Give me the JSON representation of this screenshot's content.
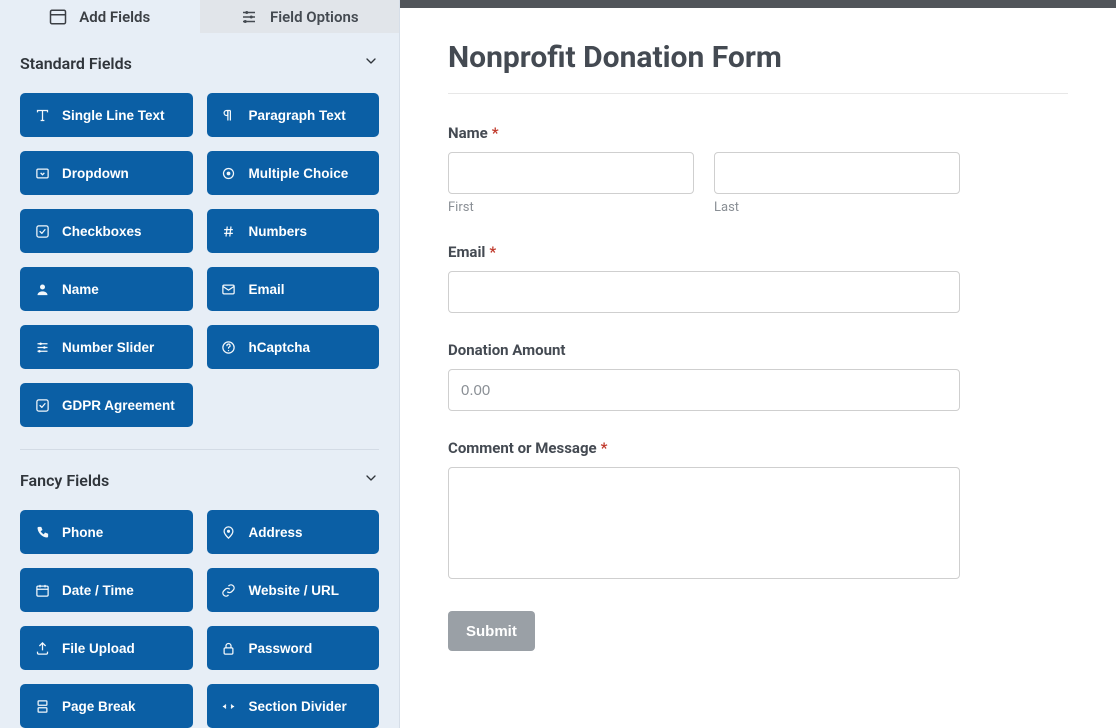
{
  "tabs": {
    "add_fields": "Add Fields",
    "field_options": "Field Options"
  },
  "sections": {
    "standard": {
      "title": "Standard Fields",
      "items": [
        {
          "label": "Single Line Text",
          "icon": "text"
        },
        {
          "label": "Paragraph Text",
          "icon": "paragraph"
        },
        {
          "label": "Dropdown",
          "icon": "dropdown"
        },
        {
          "label": "Multiple Choice",
          "icon": "radio"
        },
        {
          "label": "Checkboxes",
          "icon": "check"
        },
        {
          "label": "Numbers",
          "icon": "hash"
        },
        {
          "label": "Name",
          "icon": "user"
        },
        {
          "label": "Email",
          "icon": "mail"
        },
        {
          "label": "Number Slider",
          "icon": "sliders"
        },
        {
          "label": "hCaptcha",
          "icon": "help"
        },
        {
          "label": "GDPR Agreement",
          "icon": "check"
        }
      ]
    },
    "fancy": {
      "title": "Fancy Fields",
      "items": [
        {
          "label": "Phone",
          "icon": "phone"
        },
        {
          "label": "Address",
          "icon": "pin"
        },
        {
          "label": "Date / Time",
          "icon": "calendar"
        },
        {
          "label": "Website / URL",
          "icon": "link"
        },
        {
          "label": "File Upload",
          "icon": "upload"
        },
        {
          "label": "Password",
          "icon": "lock"
        },
        {
          "label": "Page Break",
          "icon": "pagebreak"
        },
        {
          "label": "Section Divider",
          "icon": "divider"
        }
      ]
    }
  },
  "form": {
    "title": "Nonprofit Donation Form",
    "name_label": "Name",
    "first_sub": "First",
    "last_sub": "Last",
    "email_label": "Email",
    "donation_label": "Donation Amount",
    "donation_placeholder": "0.00",
    "comment_label": "Comment or Message",
    "submit_label": "Submit"
  }
}
